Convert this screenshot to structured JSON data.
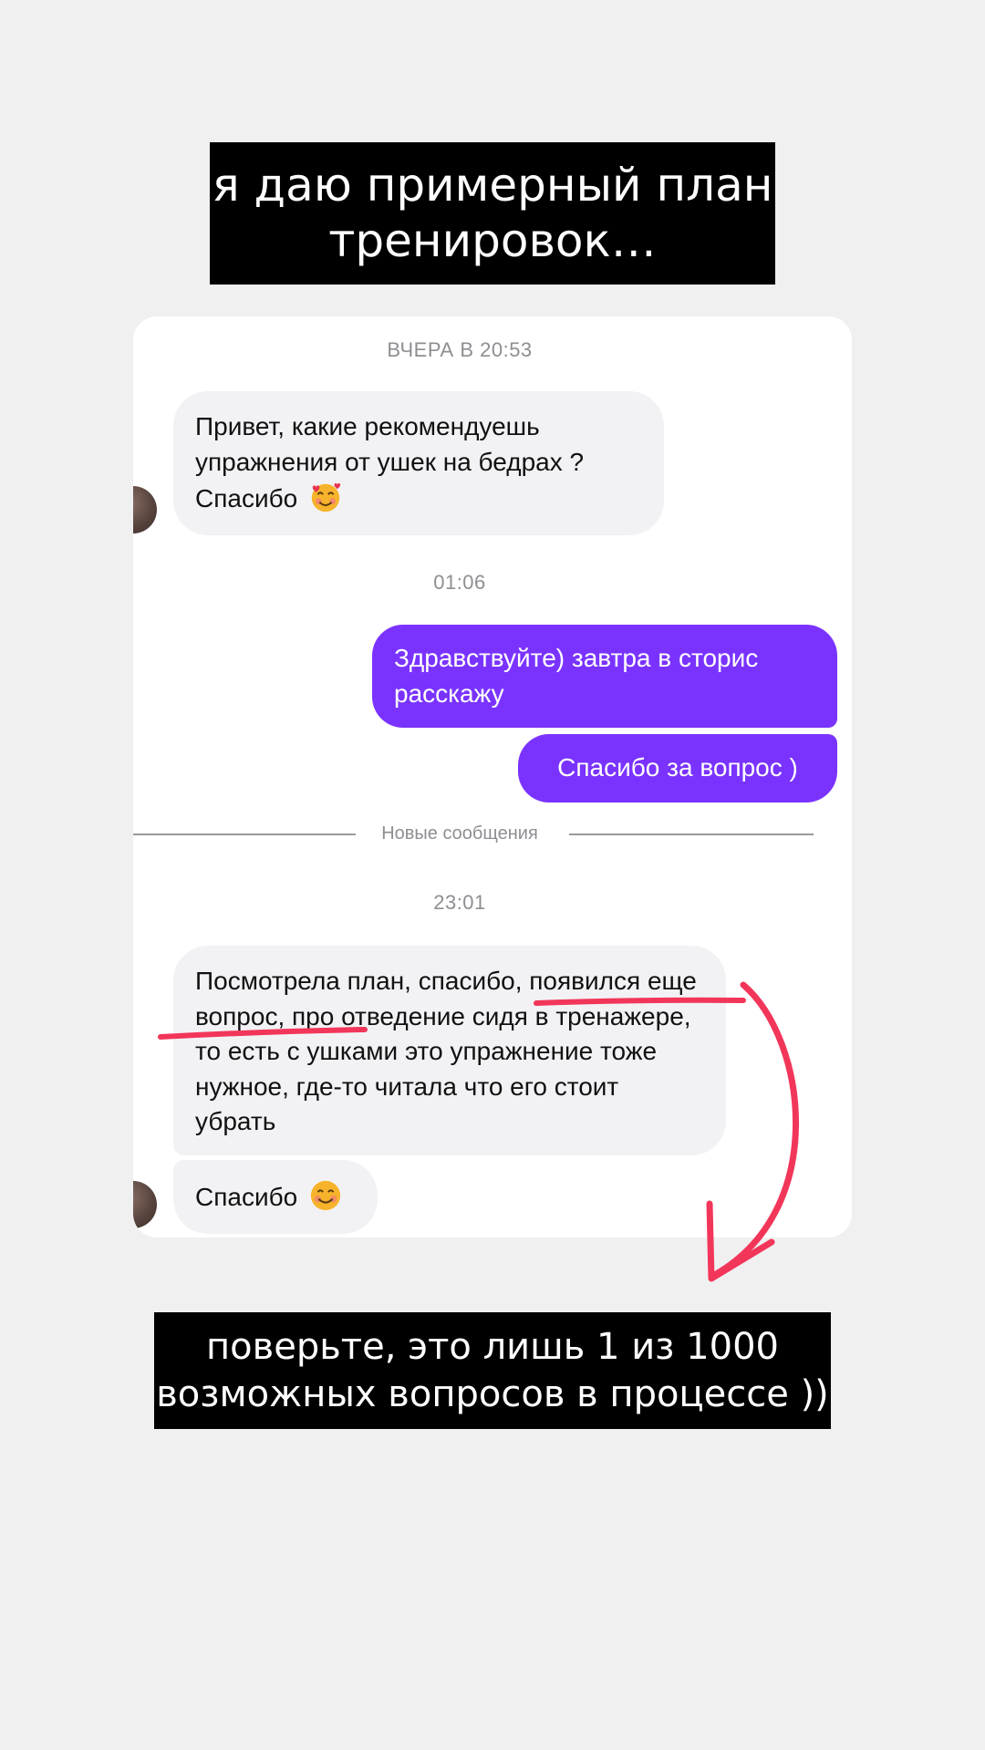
{
  "story": {
    "caption_top_line1": "я даю примерный план",
    "caption_top_line2": "тренировок…",
    "caption_bottom_line1": "поверьте, это лишь 1 из 1000",
    "caption_bottom_line2": "возможных вопросов в процессе ))"
  },
  "chat": {
    "timestamp_1": "ВЧЕРА В 20:53",
    "msg_in_1": "Привет, какие рекомендуешь упражнения от ушек на бедрах ? Спасибо",
    "msg_in_1_emoji": "smiling-face-with-hearts-icon",
    "timestamp_2": "01:06",
    "msg_out_1": "Здравствуйте) завтра в сторис расскажу",
    "msg_out_2": "Спасибо за вопрос )",
    "new_messages_label": "Новые сообщения",
    "timestamp_3": "23:01",
    "msg_in_2": "Посмотрела план, спасибо, появился еще вопрос, про отведение сидя в тренажере, то есть с ушками это упражнение тоже нужное, где-то читала что его стоит убрать",
    "msg_in_3": "Спасибо",
    "msg_in_3_emoji": "smiling-face-icon"
  },
  "colors": {
    "outgoing_bubble": "#7a33ff",
    "incoming_bubble": "#f2f2f5",
    "annotation": "#f2365a",
    "caption_background": "#000000"
  }
}
